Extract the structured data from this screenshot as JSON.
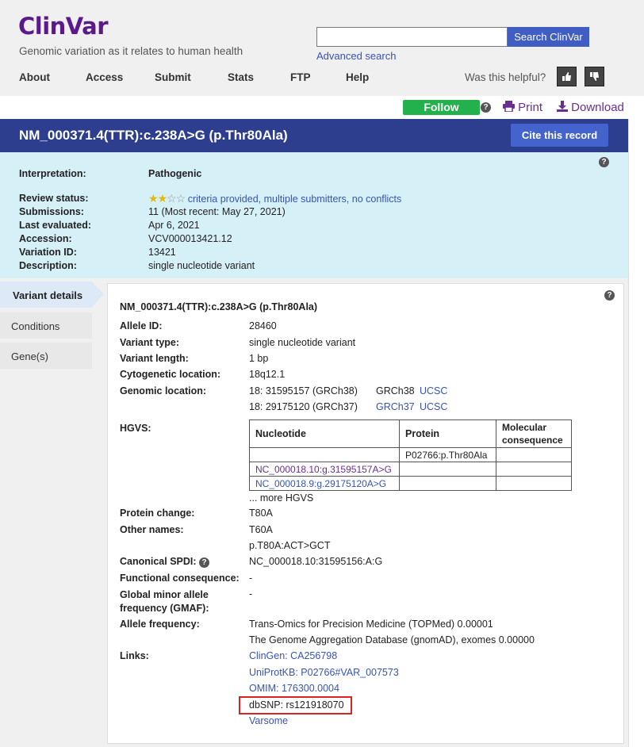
{
  "header": {
    "logo": "ClinVar",
    "tagline": "Genomic variation as it relates to human health",
    "search_button": "Search ClinVar",
    "search_placeholder": "",
    "advanced_search": "Advanced search",
    "nav": [
      "About",
      "Access",
      "Submit",
      "Stats",
      "FTP",
      "Help"
    ],
    "helpful": "Was this helpful?"
  },
  "actions": {
    "follow": "Follow",
    "print": "Print",
    "download": "Download"
  },
  "title": {
    "text": "NM_000371.4(TTR):c.238A>G (p.Thr80Ala)",
    "cite": "Cite this record"
  },
  "summary": {
    "interpretation_label": "Interpretation:",
    "interpretation": "Pathogenic",
    "review_label": "Review status:",
    "review_stars": 2,
    "review_text": "criteria provided, multiple submitters, no conflicts",
    "submissions_label": "Submissions:",
    "submissions": "11 (Most recent: May 27, 2021)",
    "evaluated_label": "Last evaluated:",
    "evaluated": "Apr 6, 2021",
    "accession_label": "Accession:",
    "accession": "VCV000013421.12",
    "variation_label": "Variation ID:",
    "variation": "13421",
    "description_label": "Description:",
    "description": "single nucleotide variant"
  },
  "tabs": [
    "Variant details",
    "Conditions",
    "Gene(s)"
  ],
  "details": {
    "heading": "NM_000371.4(TTR):c.238A>G (p.Thr80Ala)",
    "allele_id_label": "Allele ID:",
    "allele_id": "28460",
    "variant_type_label": "Variant type:",
    "variant_type": "single nucleotide variant",
    "variant_length_label": "Variant length:",
    "variant_length": "1 bp",
    "cyto_label": "Cytogenetic location:",
    "cyto": "18q12.1",
    "genomic_label": "Genomic location:",
    "genomic": [
      {
        "loc": "18: 31595157 (GRCh38)",
        "link1": "GRCh38",
        "link2": "UCSC"
      },
      {
        "loc": "18: 29175120 (GRCh37)",
        "link1": "GRCh37",
        "link2": "UCSC"
      }
    ],
    "hgvs_label": "HGVS:",
    "hgvs_headers": [
      "Nucleotide",
      "Protein",
      "Molecular consequence"
    ],
    "hgvs_rows": [
      [
        "",
        "P02766:p.Thr80Ala",
        ""
      ],
      [
        "NC_000018.10:g.31595157A>G",
        "",
        ""
      ],
      [
        "NC_000018.9:g.29175120A>G",
        "",
        ""
      ]
    ],
    "more_hgvs": "... more HGVS",
    "protein_change_label": "Protein change:",
    "protein_change": "T80A",
    "other_names_label": "Other names:",
    "other_names": [
      "T60A",
      "p.T80A:ACT>GCT"
    ],
    "spdi_label": "Canonical SPDI:",
    "spdi": "NC_000018.10:31595156:A:G",
    "functional_label": "Functional consequence:",
    "functional": "-",
    "gmaf_label": "Global minor allele frequency (GMAF):",
    "gmaf": "-",
    "allele_freq_label": "Allele frequency:",
    "allele_freq": [
      "Trans-Omics for Precision Medicine (TOPMed) 0.00001",
      "The Genome Aggregation Database (gnomAD), exomes 0.00000"
    ],
    "links_label": "Links:",
    "links": [
      "ClinGen: CA256798",
      "UniProtKB: P02766#VAR_007573",
      "OMIM: 176300.0004",
      "dbSNP: rs121918070",
      "Varsome"
    ]
  }
}
